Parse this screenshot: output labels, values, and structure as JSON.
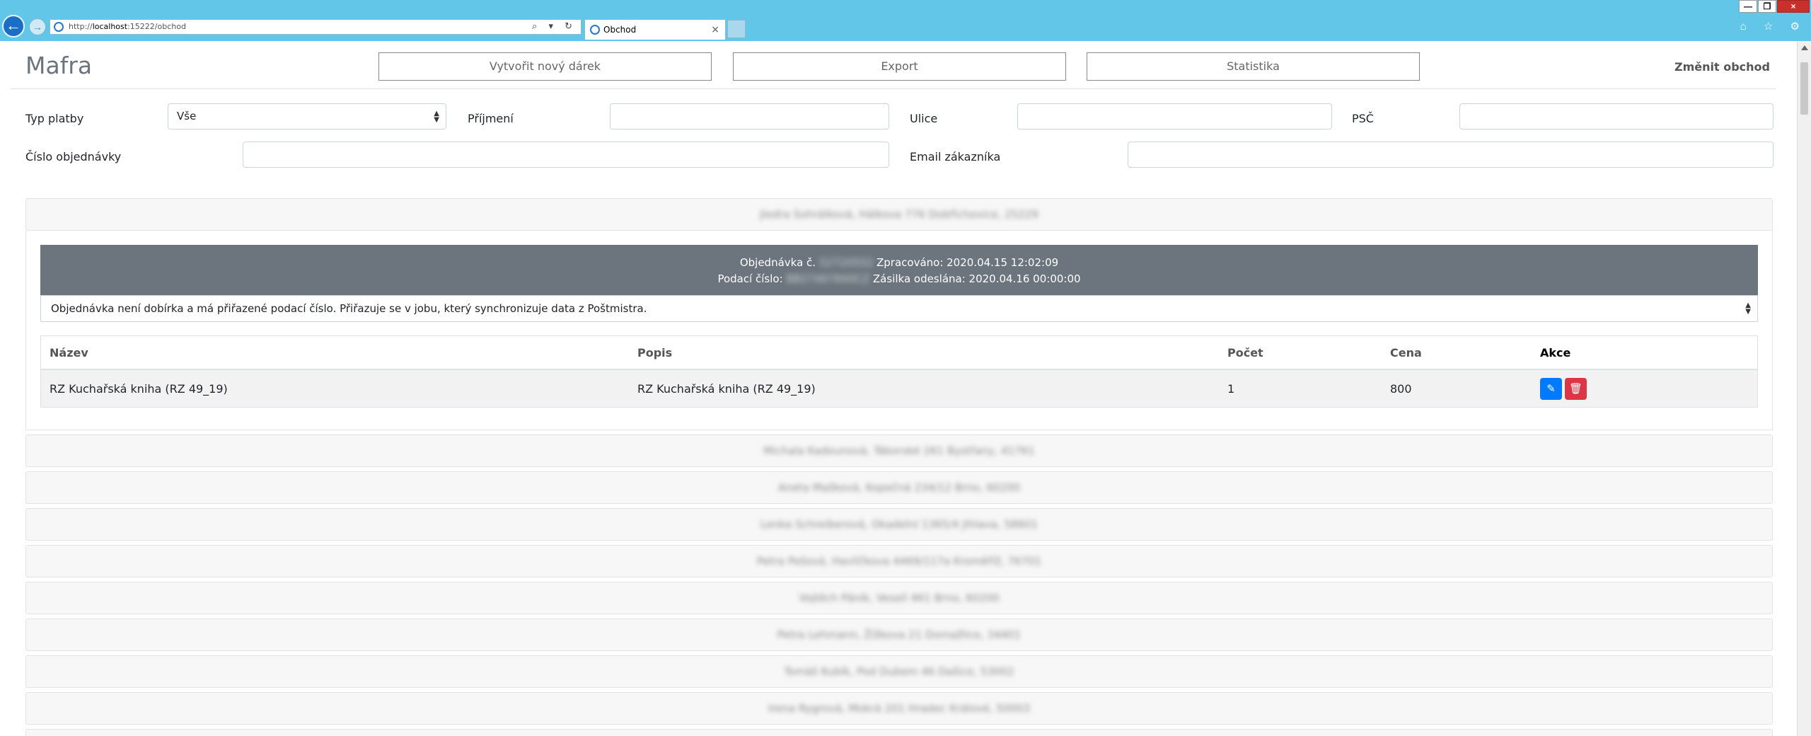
{
  "browser": {
    "url_prefix": "http://",
    "url_host": "localhost",
    "url_rest": ":15222/obchod",
    "address_tools": "⌕ ▾ ↻",
    "tab_title": "Obchod",
    "tab_close": "×",
    "window_controls": [
      "—",
      "❐",
      "×"
    ],
    "toolbar_icons": "⌂ ☆ ⚙"
  },
  "header": {
    "brand": "Mafra",
    "buttons": [
      "Vytvořit nový dárek",
      "Export",
      "Statistika"
    ],
    "change_shop": "Změnit obchod"
  },
  "filters": {
    "payment_type_label": "Typ platby",
    "payment_type_value": "Vše",
    "surname_label": "Příjmení",
    "street_label": "Ulice",
    "zip_label": "PSČ",
    "order_number_label": "Číslo objednávky",
    "email_label": "Email zákazníka"
  },
  "orders": {
    "expanded_customer": "Jiedra Sohrálková, Hálkova 776 Dobřichovice, 25229",
    "detail": {
      "order_prefix": "Objednávka č.",
      "order_number_masked": "52720552",
      "processed": "Zpracováno: 2020.04.15 12:02:09",
      "tracking_prefix": "Podací číslo:",
      "tracking_masked": "BB27467840CZ",
      "shipped": "Zásilka odeslána: 2020.04.16 00:00:00",
      "status_text": "Objednávka není dobírka a má přiřazené podací číslo. Přiřazuje se v jobu, který synchronizuje data z Poštmistra.",
      "columns": [
        "Název",
        "Popis",
        "Počet",
        "Cena",
        "Akce"
      ],
      "items": [
        {
          "name": "RZ Kuchařská kniha (RZ 49_19)",
          "description": "RZ Kuchařská kniha (RZ 49_19)",
          "count": "1",
          "price": "800"
        }
      ],
      "edit_icon": "✎",
      "delete_icon": "🗑"
    },
    "collapsed_customers": [
      "Michala Kadounová, Táborské 261 Bystřany, 41761",
      "Aneta Mašková, Kopečná 234/12 Brno, 60200",
      "Lenka Schreiberová, Okadelní 1365/4 Jihlava, 58601",
      "Petra Pešová, Havlíčkova 4469/117a Kroměříž, 76701",
      "Vojtěch Pánik, Veselí 461 Brno, 60200",
      "Petra Lehmann, Žižkova 21 Domažlice, 34401",
      "Tomáš Kubík, Pod Dubem 46 Dašice, 53002",
      "Irena Rygrová, Mokrá 201 Hradec Králové, 50003",
      ""
    ]
  }
}
